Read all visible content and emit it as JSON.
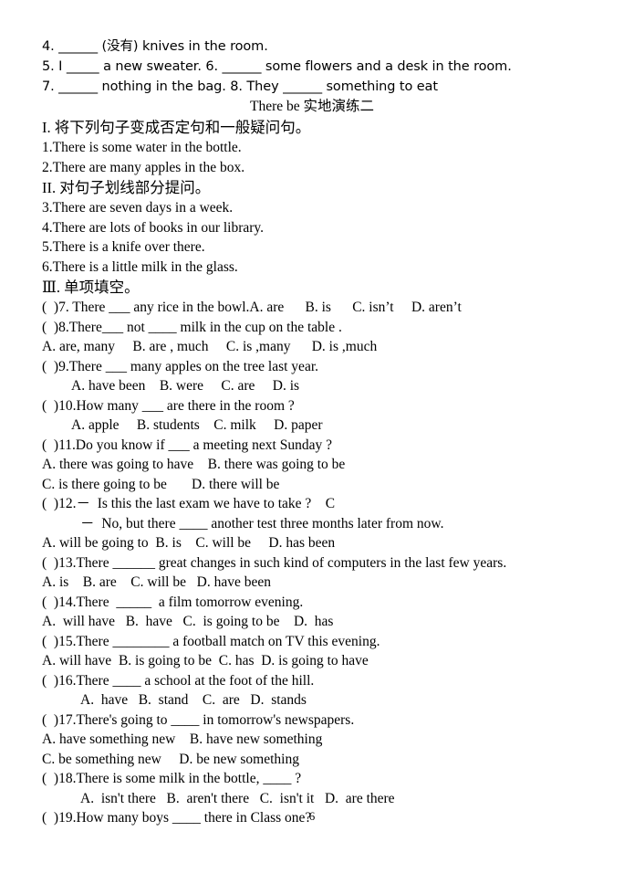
{
  "document": {
    "page_number": "6",
    "title": "There be 实地演练二",
    "top_fill_in_lines": [
      "4. ______ (没有) knives in the room.",
      "5. I _____ a new sweater. 6. ______ some flowers and a desk in the room.",
      "7. ______ nothing in the bag. 8. They ______ something to eat"
    ],
    "sections": [
      {
        "heading": "I. 将下列句子变成否定句和一般疑问句。",
        "items": [
          "1.There is some water in the bottle.",
          "2.There are many apples in the box."
        ]
      },
      {
        "heading": "II. 对句子划线部分提问。",
        "items": [
          "3.There are seven days in a week.",
          "4.There are lots of books in our library.",
          "5.There is a knife over there.",
          "6.There is a little milk in the glass."
        ]
      },
      {
        "heading": "Ⅲ. 单项填空。",
        "items": []
      }
    ],
    "multiple_choice": [
      {
        "number": "7",
        "stem": "(  )7. There ___ any rice in the bowl.",
        "inline_options": "A. are      B. is      C. isn’t     D. aren’t",
        "option_lines": []
      },
      {
        "number": "8",
        "stem": "(  )8.There___ not ____ milk in the cup on the table .",
        "inline_options": "",
        "option_lines": [
          {
            "text": "A. are, many     B. are , much     C. is ,many      D. is ,much",
            "indent": "none"
          }
        ]
      },
      {
        "number": "9",
        "stem": "(  )9.There ___ many apples on the tree last year.",
        "inline_options": "",
        "option_lines": [
          {
            "text": "A. have been    B. were     C. are     D. is",
            "indent": "small"
          }
        ]
      },
      {
        "number": "10",
        "stem": "(  )10.How many ___ are there in the room ?",
        "inline_options": "",
        "option_lines": [
          {
            "text": "A. apple     B. students    C. milk     D. paper",
            "indent": "small"
          }
        ]
      },
      {
        "number": "11",
        "stem": "(  )11.Do you know if ___ a meeting next Sunday ?",
        "inline_options": "",
        "option_lines": [
          {
            "text": "A. there was going to have    B. there was going to be",
            "indent": "none"
          },
          {
            "text": "C. is there going to be       D. there will be",
            "indent": "none"
          }
        ]
      },
      {
        "number": "12",
        "stem": "(  )12.－  Is this the last exam we have to take ?    C",
        "sub_stem": "－  No, but there ____ another test three months later from now.",
        "inline_options": "",
        "option_lines": [
          {
            "text": "A. will be going to  B. is    C. will be     D. has been",
            "indent": "none"
          }
        ]
      },
      {
        "number": "13",
        "stem": "(  )13.There ______ great changes in such kind of computers in the last few years.",
        "inline_options": "",
        "option_lines": [
          {
            "text": "A. is    B. are    C. will be   D. have been",
            "indent": "none"
          }
        ]
      },
      {
        "number": "14",
        "stem": "(  )14.There  _____  a film tomorrow evening.",
        "inline_options": "",
        "option_lines": [
          {
            "text": "A.  will have   B.  have   C.  is going to be    D.  has",
            "indent": "none"
          }
        ]
      },
      {
        "number": "15",
        "stem": "(  )15.There ________ a football match on TV this evening.",
        "inline_options": "",
        "option_lines": [
          {
            "text": "A. will have  B. is going to be  C. has  D. is going to have",
            "indent": "none"
          }
        ]
      },
      {
        "number": "16",
        "stem": "(  )16.There ____ a school at the foot of the hill.",
        "inline_options": "",
        "option_lines": [
          {
            "text": "A.  have   B.  stand    C.  are   D.  stands",
            "indent": "large"
          }
        ]
      },
      {
        "number": "17",
        "stem": "(  )17.There's going to ____ in tomorrow's newspapers.",
        "inline_options": "",
        "option_lines": [
          {
            "text": "A. have something new    B. have new something",
            "indent": "none"
          },
          {
            "text": "C. be something new     D. be new something",
            "indent": "none"
          }
        ]
      },
      {
        "number": "18",
        "stem": "(  )18.There is some milk in the bottle, ____ ?",
        "inline_options": "",
        "option_lines": [
          {
            "text": "A.  isn't there   B.  aren't there   C.  isn't it   D.  are there",
            "indent": "large"
          }
        ]
      },
      {
        "number": "19",
        "stem": "(  )19.How many boys ____ there in Class one?",
        "inline_options": "",
        "option_lines": []
      }
    ]
  }
}
